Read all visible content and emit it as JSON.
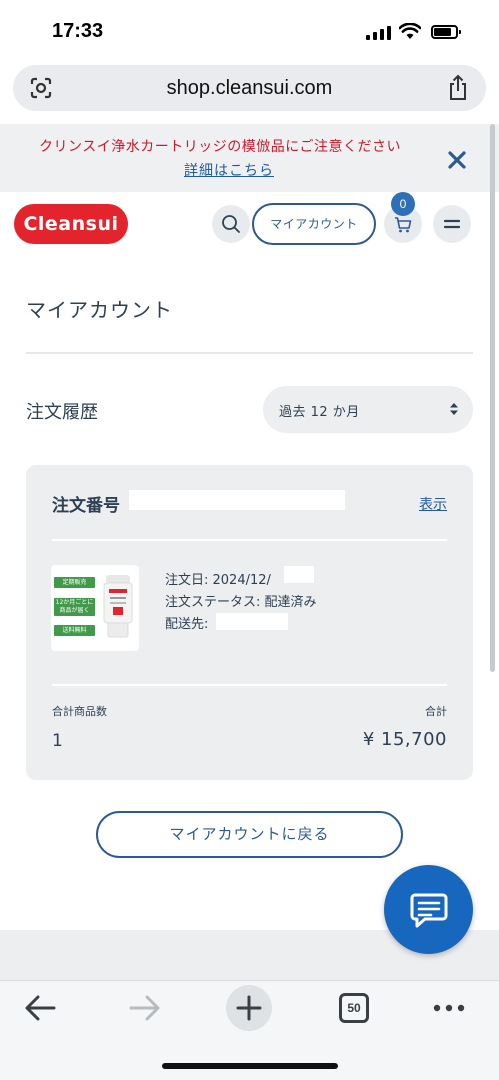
{
  "status_bar": {
    "time": "17:33"
  },
  "browser": {
    "url": "shop.cleansui.com",
    "tabs_count": "50"
  },
  "notice": {
    "message": "クリンスイ浄水カートリッジの模倣品にご注意ください",
    "link": "詳細はこちら"
  },
  "header": {
    "logo": "Cleansui",
    "account_label": "マイアカウント",
    "cart_count": "0"
  },
  "page": {
    "title": "マイアカウント"
  },
  "orders": {
    "label": "注文履歴",
    "period_selected": "過去 12 か月"
  },
  "order": {
    "number_label": "注文番号",
    "view_link": "表示",
    "product_tags": [
      "定期販売",
      "12か月ごとに商品が届く",
      "送料無料"
    ],
    "order_date": "注文日: 2024/12/",
    "status": "注文ステータス: 配達済み",
    "ship_to": "配送先:",
    "qty_label": "合計商品数",
    "qty_value": "1",
    "total_label": "合計",
    "total_value": "¥ 15,700"
  },
  "back_button": "マイアカウントに戻る",
  "colors": {
    "brand_red": "#e4242c",
    "accent_blue": "#2c5a94",
    "notice_red": "#d0182b",
    "fab_blue": "#1767bf"
  }
}
